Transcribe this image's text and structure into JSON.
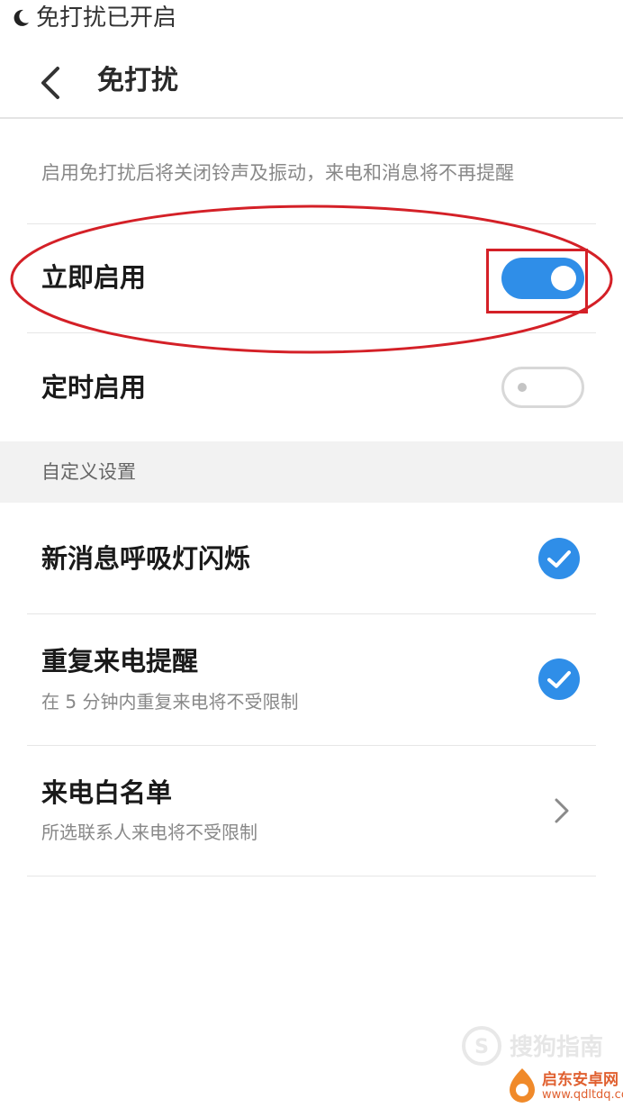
{
  "status_bar": {
    "text": "免打扰已开启",
    "icon": "moon-icon"
  },
  "header": {
    "title": "免打扰",
    "back_icon": "chevron-left-icon"
  },
  "description": "启用免打扰后将关闭铃声及振动，来电和消息将不再提醒",
  "toggles": [
    {
      "label": "立即启用",
      "state": "on"
    },
    {
      "label": "定时启用",
      "state": "off"
    }
  ],
  "section": {
    "title": "自定义设置"
  },
  "settings": [
    {
      "title": "新消息呼吸灯闪烁",
      "subtitle": "",
      "control": "check-icon",
      "checked": true
    },
    {
      "title": "重复来电提醒",
      "subtitle": "在 5 分钟内重复来电将不受限制",
      "control": "check-icon",
      "checked": true
    },
    {
      "title": "来电白名单",
      "subtitle": "所选联系人来电将不受限制",
      "control": "chevron-right-icon"
    }
  ],
  "colors": {
    "accent": "#2f8ee8",
    "annotation": "#d42027"
  },
  "watermark": {
    "brand1": "搜狗指南",
    "brand2": "启东安卓网",
    "url": "www.qdltdq.com"
  }
}
